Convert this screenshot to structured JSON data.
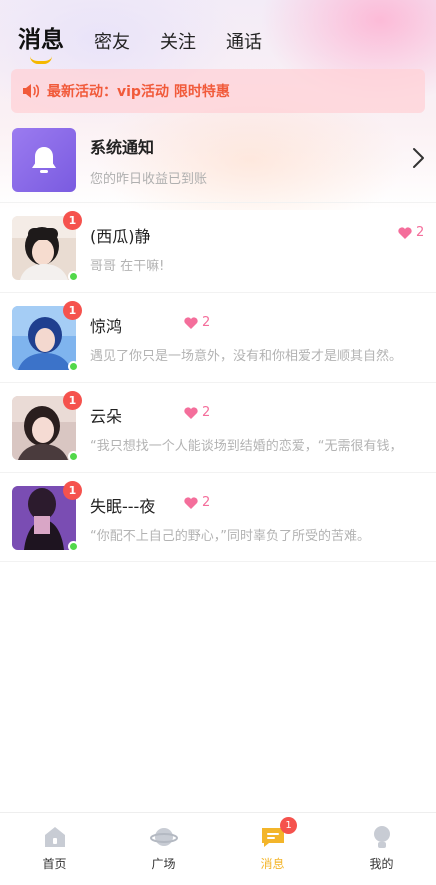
{
  "tabs": [
    {
      "label": "消息",
      "active": true
    },
    {
      "label": "密友",
      "active": false
    },
    {
      "label": "关注",
      "active": false
    },
    {
      "label": "通话",
      "active": false
    }
  ],
  "notice": {
    "icon": "speaker-icon",
    "text": "最新活动：vip活动 限时特惠",
    "color": "#f15a3a"
  },
  "system": {
    "title": "系统通知",
    "subtitle": "您的昨日收益已到账",
    "icon": "bell-icon"
  },
  "messages": [
    {
      "name": "(西瓜)静",
      "preview": "哥哥 在干嘛!",
      "unread": "1",
      "intimacy": "2"
    },
    {
      "name": "惊鸿",
      "preview": "遇见了你只是一场意外，没有和你相爱才是顺其自然。",
      "unread": "1",
      "intimacy": "2"
    },
    {
      "name": "云朵",
      "preview": "“我只想找一个人能谈场到结婚的恋爱，“无需很有钱，",
      "unread": "1",
      "intimacy": "2"
    },
    {
      "name": "失眠---夜",
      "preview": "“你配不上自己的野心，”同时辜负了所受的苦难。",
      "unread": "1",
      "intimacy": "2"
    }
  ],
  "bottom_nav": [
    {
      "label": "首页",
      "icon": "home-icon"
    },
    {
      "label": "广场",
      "icon": "planet-icon"
    },
    {
      "label": "消息",
      "icon": "message-icon",
      "badge": "1",
      "active": true
    },
    {
      "label": "我的",
      "icon": "profile-icon"
    }
  ],
  "colors": {
    "accent": "#f3b52a",
    "badge": "#f5524d",
    "online": "#52d84a",
    "intimacy": "#f46e9b"
  }
}
